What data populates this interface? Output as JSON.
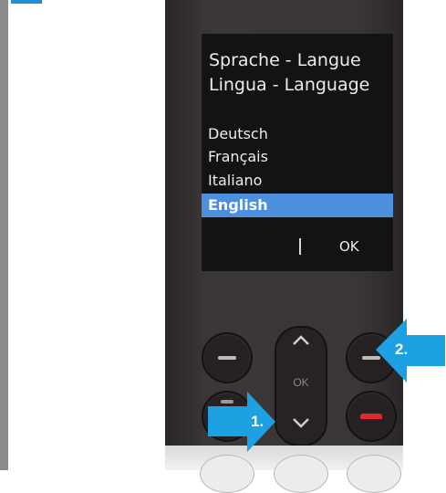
{
  "screen": {
    "title_line1": "Sprache - Langue",
    "title_line2": "Lingua - Language",
    "options": [
      "Deutsch",
      "Français",
      "Italiano",
      "English"
    ],
    "selected_option": "English",
    "softkey_right": "OK"
  },
  "keys": {
    "nav_center_label": "OK"
  },
  "callouts": {
    "step1": "1.",
    "step2": "2."
  },
  "colors": {
    "highlight": "#4c8fdc",
    "callout_arrow": "#1da1e2",
    "end_call_key": "#e2282c"
  },
  "icons": {
    "left_softkey": "minus-icon",
    "right_softkey": "minus-icon",
    "nav_up": "chevron-up-icon",
    "nav_down": "chevron-down-icon",
    "end_call": "handset-hangup-icon",
    "call": "handset-icon"
  }
}
